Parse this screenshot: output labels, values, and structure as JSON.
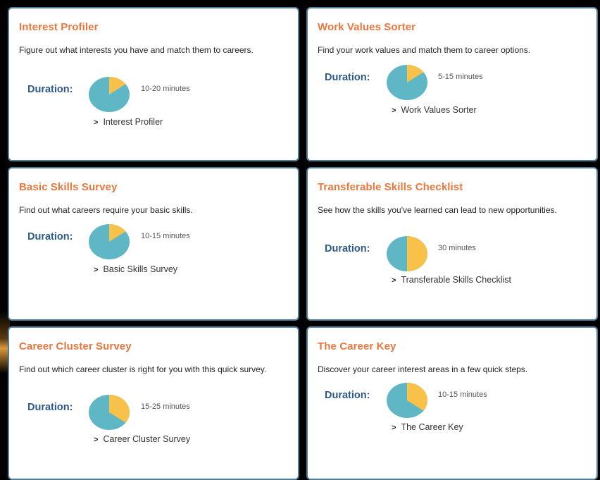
{
  "colors": {
    "title": "#e8773d",
    "duration": "#2d5a8a",
    "border": "#4d7c9c",
    "pie_teal": "#5fb7c5",
    "pie_yellow": "#f8c14a"
  },
  "cards": [
    {
      "title": "Interest Profiler",
      "description": "Figure out what interests you have and match them to careers.",
      "duration_label": "Duration:",
      "duration_value": "10-20 minutes",
      "link_label": "Interest Profiler",
      "pie_fraction": 0.15
    },
    {
      "title": "Work Values Sorter",
      "description": "Find your work values and match them to career options.",
      "duration_label": "Duration:",
      "duration_value": "5-15 minutes",
      "link_label": "Work Values Sorter",
      "pie_fraction": 0.15
    },
    {
      "title": "Basic Skills Survey",
      "description": "Find out what careers require your basic skills.",
      "duration_label": "Duration:",
      "duration_value": "10-15 minutes",
      "link_label": "Basic Skills Survey",
      "pie_fraction": 0.15
    },
    {
      "title": "Transferable Skills Checklist",
      "description": "See how the skills you've learned can lead to new opportunities.",
      "duration_label": "Duration:",
      "duration_value": "30 minutes",
      "link_label": "Transferable Skills Checklist",
      "pie_fraction": 0.5
    },
    {
      "title": "Career Cluster Survey",
      "description": "Find out which career cluster is right for you with this quick survey.",
      "duration_label": "Duration:",
      "duration_value": "15-25 minutes",
      "link_label": "Career Cluster Survey",
      "pie_fraction": 0.35
    },
    {
      "title": "The Career Key",
      "description": "Discover your career interest areas in a few quick steps.",
      "duration_label": "Duration:",
      "duration_value": "10-15 minutes",
      "link_label": "The Career Key",
      "pie_fraction": 0.35
    }
  ],
  "link_chevron": ">"
}
